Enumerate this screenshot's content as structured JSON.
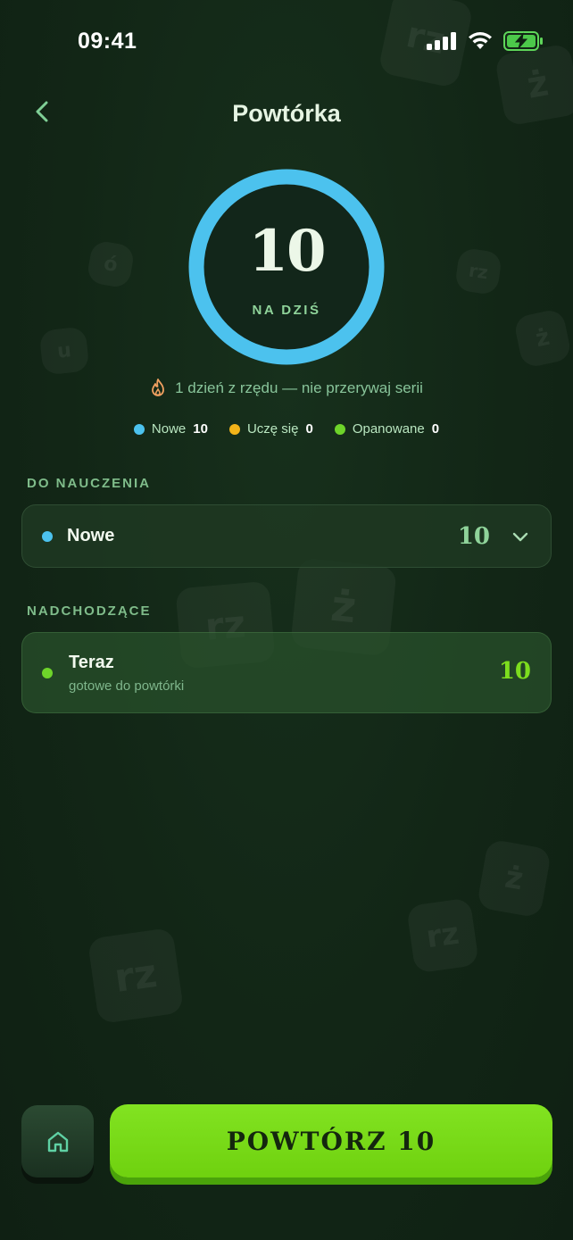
{
  "status_bar": {
    "time": "09:41"
  },
  "header": {
    "title": "Powtórka"
  },
  "ring": {
    "count": "10",
    "label": "NA DZIŚ",
    "color": "#4cc2ee"
  },
  "streak": {
    "text": "1 dzień z rzędu — nie przerywaj serii",
    "icon": "flame-icon"
  },
  "legend": [
    {
      "label": "Nowe",
      "count": "10",
      "color": "#4cc2ee"
    },
    {
      "label": "Uczę się",
      "count": "0",
      "color": "#f3b419"
    },
    {
      "label": "Opanowane",
      "count": "0",
      "color": "#6ed42a"
    }
  ],
  "sections": {
    "to_learn": {
      "label": "DO NAUCZENIA",
      "card": {
        "title": "Nowe",
        "count": "10",
        "dot_color": "#4cc2ee",
        "count_color": "#8fd39a"
      }
    },
    "upcoming": {
      "label": "NADCHODZĄCE",
      "card": {
        "title": "Teraz",
        "subtitle": "gotowe do powtórki",
        "count": "10",
        "dot_color": "#6ed42a",
        "count_color": "#7ddd1e"
      }
    }
  },
  "footer": {
    "cta_label": "POWTÓRZ 10",
    "home_icon": "home-icon"
  },
  "colors": {
    "accent_green": "#7ddd1e",
    "accent_blue": "#4cc2ee",
    "background": "#122616"
  }
}
